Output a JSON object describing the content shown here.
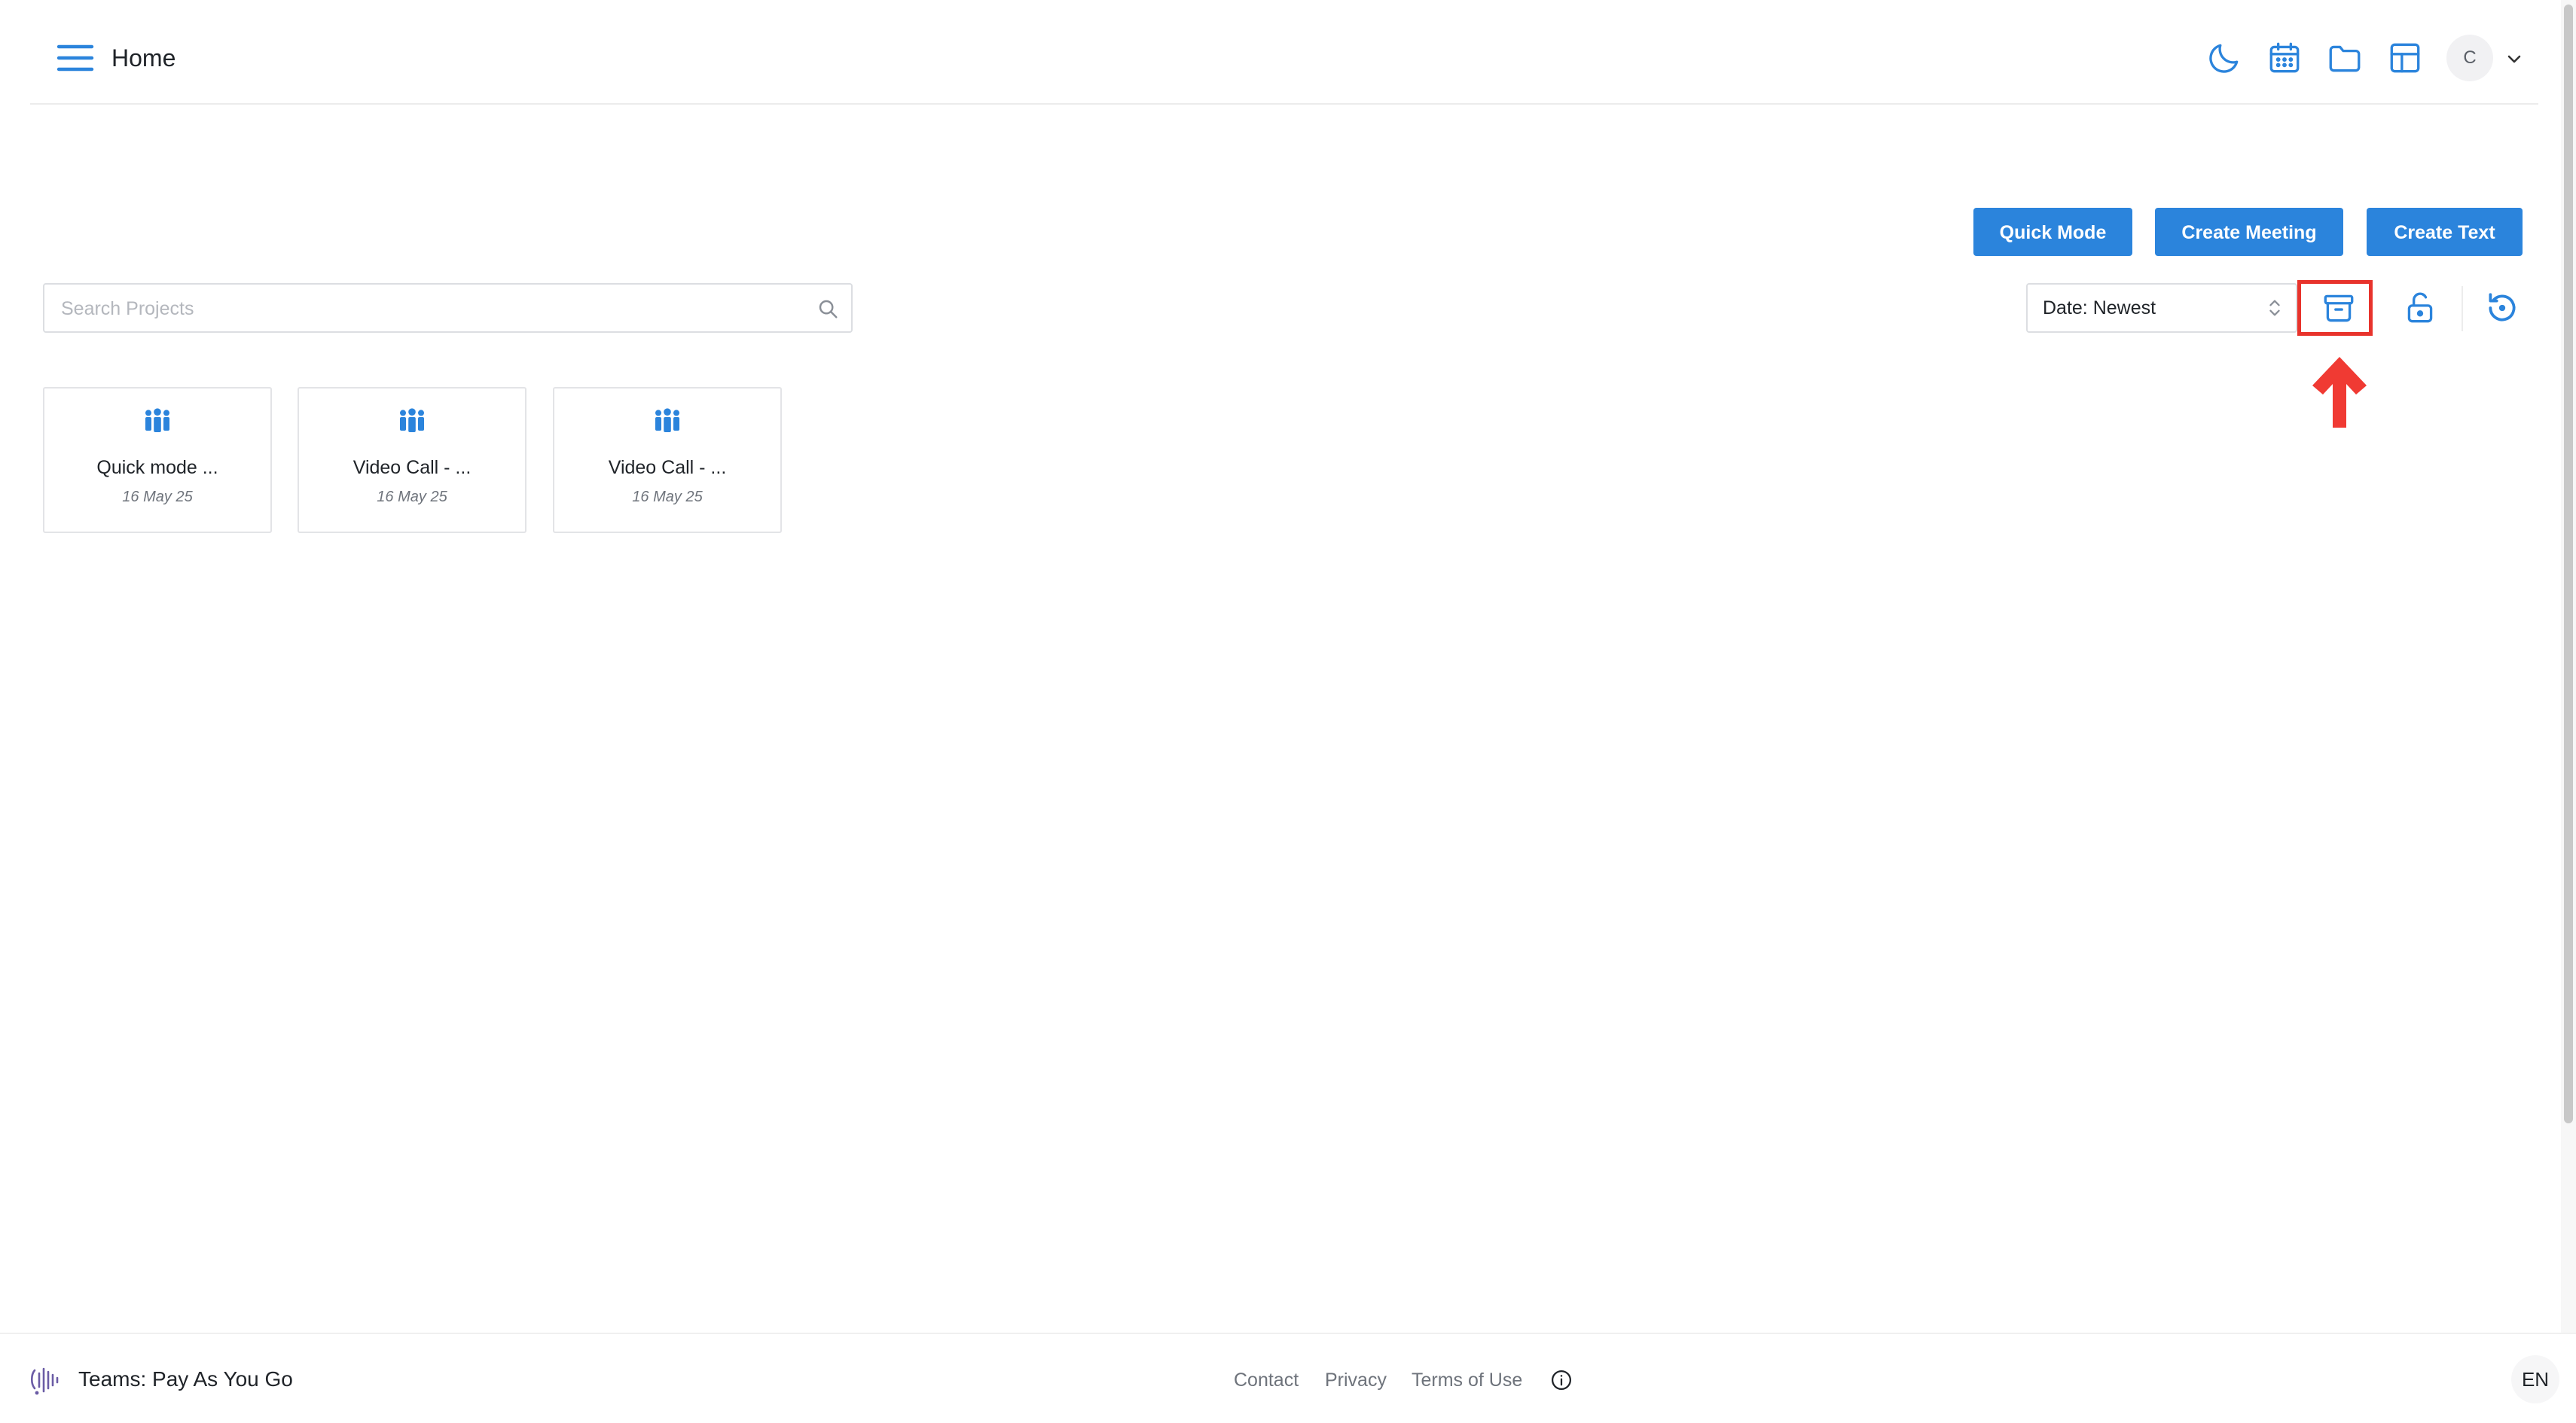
{
  "header": {
    "title": "Home",
    "icons": [
      "menu-icon",
      "moon-icon",
      "calendar-icon",
      "folder-icon",
      "layout-grid-icon"
    ],
    "avatar_initial": "C"
  },
  "actions": {
    "quick_mode": "Quick Mode",
    "create_meeting": "Create Meeting",
    "create_text": "Create Text"
  },
  "search": {
    "placeholder": "Search Projects",
    "value": ""
  },
  "sort": {
    "selected": "Date: Newest"
  },
  "toolbar": {
    "icons": [
      "archive-icon",
      "unlock-icon",
      "history-icon"
    ]
  },
  "projects": [
    {
      "title": "Quick mode ...",
      "date": "16 May 25",
      "icon": "people-group-icon"
    },
    {
      "title": "Video Call - ...",
      "date": "16 May 25",
      "icon": "people-group-icon"
    },
    {
      "title": "Video Call - ...",
      "date": "16 May 25",
      "icon": "people-group-icon"
    }
  ],
  "footer": {
    "brand": "Teams: Pay As You Go",
    "links": [
      "Contact",
      "Privacy",
      "Terms of Use"
    ],
    "language": "EN"
  },
  "colors": {
    "accent": "#2b84dc",
    "highlight": "#e8332c"
  }
}
